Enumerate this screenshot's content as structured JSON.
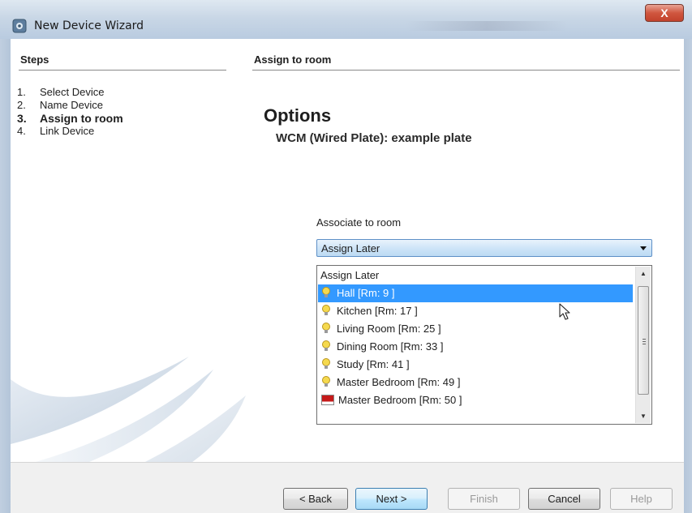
{
  "window": {
    "title": "New Device Wizard",
    "close_label": "X",
    "icon": "wizard-app-icon"
  },
  "steps": {
    "header": "Steps",
    "items": [
      {
        "num": "1.",
        "label": "Select Device",
        "current": false
      },
      {
        "num": "2.",
        "label": "Name Device",
        "current": false
      },
      {
        "num": "3.",
        "label": "Assign to room",
        "current": true
      },
      {
        "num": "4.",
        "label": "Link Device",
        "current": false
      }
    ]
  },
  "content": {
    "section_header": "Assign to room",
    "options_title": "Options",
    "device_name": "WCM (Wired Plate): example plate",
    "assoc_label": "Associate to room",
    "combo_value": "Assign Later",
    "dropdown_items": [
      {
        "label": "Assign Later",
        "icon": "none",
        "selected": false
      },
      {
        "label": "Hall [Rm: 9 ]",
        "icon": "lightbulb-icon",
        "selected": true
      },
      {
        "label": "Kitchen [Rm: 17 ]",
        "icon": "lightbulb-icon",
        "selected": false
      },
      {
        "label": "Living Room [Rm: 25 ]",
        "icon": "lightbulb-icon",
        "selected": false
      },
      {
        "label": "Dining Room  [Rm: 33 ]",
        "icon": "lightbulb-icon",
        "selected": false
      },
      {
        "label": "Study [Rm: 41 ]",
        "icon": "lightbulb-icon",
        "selected": false
      },
      {
        "label": "Master Bedroom [Rm: 49 ]",
        "icon": "lightbulb-icon",
        "selected": false
      },
      {
        "label": "Master Bedroom [Rm: 50 ]",
        "icon": "red-swatch-icon",
        "selected": false
      }
    ]
  },
  "buttons": {
    "back": "< Back",
    "next": "Next >",
    "finish": "Finish",
    "cancel": "Cancel",
    "help": "Help"
  },
  "colors": {
    "selection": "#3399ff",
    "combo_border": "#5e90c7",
    "swatch_red": "#c51a1a"
  }
}
